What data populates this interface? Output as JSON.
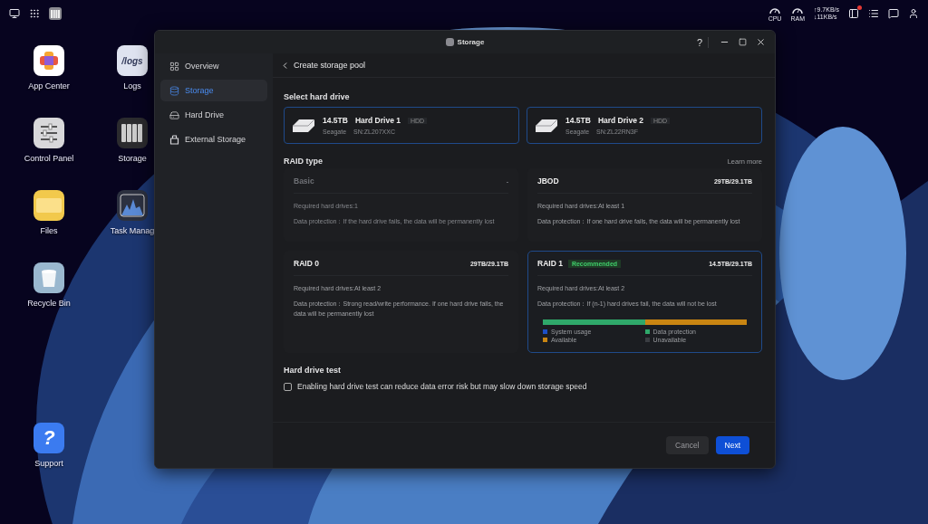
{
  "top_bar": {
    "tray": {
      "cpu_label": "CPU",
      "ram_label": "RAM",
      "upload": "↑9.7KB/s",
      "download": "↓11KB/s"
    },
    "notification": true
  },
  "desktop_icons": [
    {
      "label": "App Center",
      "kind": "app-center"
    },
    {
      "label": "Control Panel",
      "kind": "control-panel"
    },
    {
      "label": "Files",
      "kind": "files"
    },
    {
      "label": "Recycle Bin",
      "kind": "recycle-bin"
    },
    {
      "label": "Logs",
      "kind": "logs",
      "icon_text": "/logs"
    },
    {
      "label": "Storage",
      "kind": "storage"
    },
    {
      "label": "Task Manag",
      "kind": "task-manager"
    }
  ],
  "support_icon": {
    "label": "Support",
    "icon_text": "?"
  },
  "window": {
    "title": "Storage",
    "help": "?"
  },
  "sidebar": {
    "items": [
      {
        "label": "Overview",
        "kind": "overview",
        "selected": false
      },
      {
        "label": "Storage",
        "kind": "storage",
        "selected": true
      },
      {
        "label": "Hard Drive",
        "kind": "hard-drive",
        "selected": false
      },
      {
        "label": "External Storage",
        "kind": "external",
        "selected": false
      }
    ]
  },
  "page_title": "Create storage pool",
  "select_drive": {
    "title": "Select hard drive",
    "drives": [
      {
        "capacity": "14.5TB",
        "name": "Hard Drive 1",
        "type": "HDD",
        "brand": "Seagate",
        "serial": "SN:ZL207XXC",
        "selected": true
      },
      {
        "capacity": "14.5TB",
        "name": "Hard Drive 2",
        "type": "HDD",
        "brand": "Seagate",
        "serial": "SN:ZL22RN3F",
        "selected": true
      }
    ]
  },
  "raid": {
    "title": "RAID type",
    "learn_more": "Learn more",
    "options": [
      {
        "name": "Basic",
        "capacity": "-",
        "required": "Required hard drives:1",
        "protection": "Data protection：If the hard drive fails, the data will be permanently lost",
        "disabled": true,
        "selected": false
      },
      {
        "name": "JBOD",
        "capacity": "29TB/29.1TB",
        "required": "Required hard drives:At least 1",
        "protection": "Data protection：If one hard drive fails, the data will be permanently lost",
        "disabled": false,
        "selected": false
      },
      {
        "name": "RAID 0",
        "capacity": "29TB/29.1TB",
        "required": "Required hard drives:At least 2",
        "protection": "Data protection：Strong read/write performance. If one hard drive fails, the data will be permanently lost",
        "disabled": false,
        "selected": false
      },
      {
        "name": "RAID 1",
        "badge": "Recommended",
        "capacity": "14.5TB/29.1TB",
        "required": "Required hard drives:At least 2",
        "protection": "Data protection：If (n-1) hard drives fail, the data will not be lost",
        "disabled": false,
        "selected": true,
        "usage": [
          {
            "label": "System usage",
            "color": "#1d4fc4"
          },
          {
            "label": "Data protection",
            "color": "#2fa86a",
            "level": 0.5
          },
          {
            "label": "Available",
            "color": "#c98512",
            "level": 0.5
          },
          {
            "label": "Unavailable",
            "color": "#3a3d42"
          }
        ]
      }
    ]
  },
  "drive_test": {
    "title": "Hard drive test",
    "label": "Enabling hard drive test can reduce data error risk but may slow down storage speed",
    "checked": false
  },
  "buttons": [
    {
      "label": "Cancel",
      "kind": "secondary"
    },
    {
      "label": "Next",
      "kind": "primary"
    }
  ]
}
